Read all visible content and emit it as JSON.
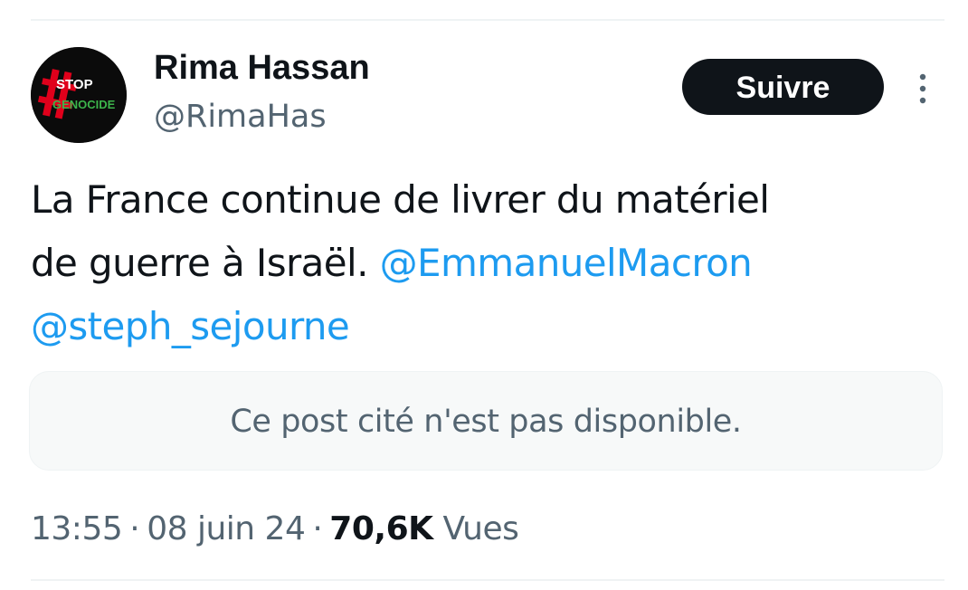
{
  "user": {
    "display_name": "Rima Hassan",
    "handle": "@RimaHas",
    "avatar_text": [
      "STOP",
      "GENOCIDE"
    ]
  },
  "follow_label": "Suivre",
  "tweet": {
    "text_line1": "La France continue de livrer du matériel",
    "text_line2_plain": "de guerre à Israël. ",
    "mention1": "@EmmanuelMacron",
    "mention2": "@steph_sejourne"
  },
  "quote": {
    "unavailable_text": "Ce post cité n'est pas disponible."
  },
  "meta": {
    "time": "13:55",
    "separator": "·",
    "date": "08 juin 24",
    "views_count": "70,6K",
    "views_label": "Vues"
  },
  "colors": {
    "link": "#1d9bf0",
    "text": "#0f1419",
    "secondary": "#536471",
    "button_bg": "#0f1419",
    "avatar_accent": "#e0001b",
    "avatar_green": "#3cb44b"
  },
  "icons": {
    "more": "more-vertical-icon",
    "avatar": "stop-genocide-logo"
  }
}
